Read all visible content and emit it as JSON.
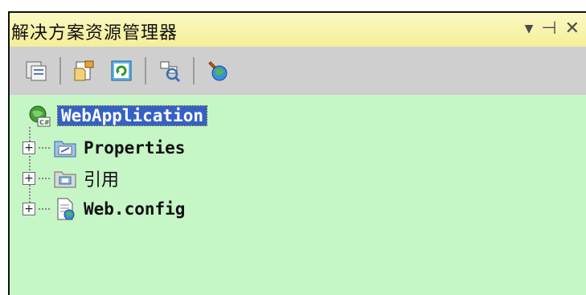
{
  "window": {
    "title": "解决方案资源管理器",
    "controls": {
      "dropdown": "▼",
      "pin": "⊣",
      "close": "✕"
    }
  },
  "toolbar": {
    "buttons": [
      {
        "icon": "properties-icon"
      },
      {
        "icon": "show-all-files-icon"
      },
      {
        "icon": "refresh-icon"
      },
      {
        "icon": "view-designer-icon"
      },
      {
        "icon": "asp-net-configuration-icon"
      }
    ]
  },
  "tree": {
    "root": {
      "label": "WebApplication",
      "icon": "web-project-icon"
    },
    "children": [
      {
        "label": "Properties",
        "icon": "properties-folder-icon",
        "expander": "+"
      },
      {
        "label": "引用",
        "icon": "references-folder-icon",
        "expander": "+"
      },
      {
        "label": "Web.config",
        "icon": "config-file-icon",
        "expander": "+"
      }
    ]
  },
  "colors": {
    "panel_bg": "#c6f5c6",
    "title_bg": "#f5ee97",
    "toolbar_bg": "#cfcfcf",
    "selection": "#3561c4"
  }
}
